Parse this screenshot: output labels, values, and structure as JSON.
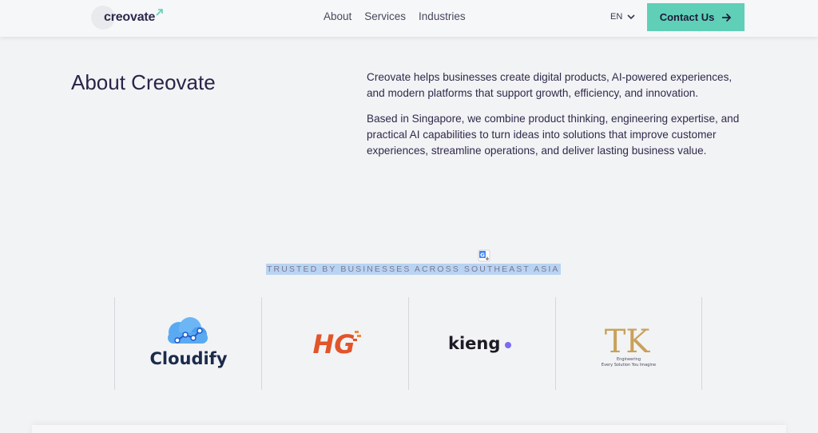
{
  "header": {
    "logo_text": "creovate",
    "nav": [
      {
        "label": "About"
      },
      {
        "label": "Services"
      },
      {
        "label": "Industries"
      }
    ],
    "language": "EN",
    "contact_label": "Contact Us"
  },
  "about": {
    "title": "About Creovate",
    "paragraphs": [
      "Creovate helps businesses create digital products, AI-powered experiences, and modern platforms that support growth, efficiency, and innovation.",
      "Based in Singapore, we combine product thinking, engineering expertise, and practical AI capabilities to turn ideas into solutions that improve customer experiences, streamline operations, and deliver lasting business value."
    ]
  },
  "trusted": {
    "heading": "TRUSTED BY BUSINESSES ACROSS SOUTHEAST ASIA",
    "logos": [
      {
        "name": "Cloudify"
      },
      {
        "name": "HG"
      },
      {
        "name": "kieng"
      },
      {
        "name": "TK",
        "tagline_1": "Engineering",
        "tagline_2": "Every Solution You Imagine"
      }
    ]
  },
  "colors": {
    "accent": "#5fd0b7",
    "text": "#2b2448",
    "highlight": "#b9d4f3",
    "kieng_dot": "#7b6cf0",
    "hg_orange": "#e2542a",
    "tk_gold": "#c9a15a"
  }
}
